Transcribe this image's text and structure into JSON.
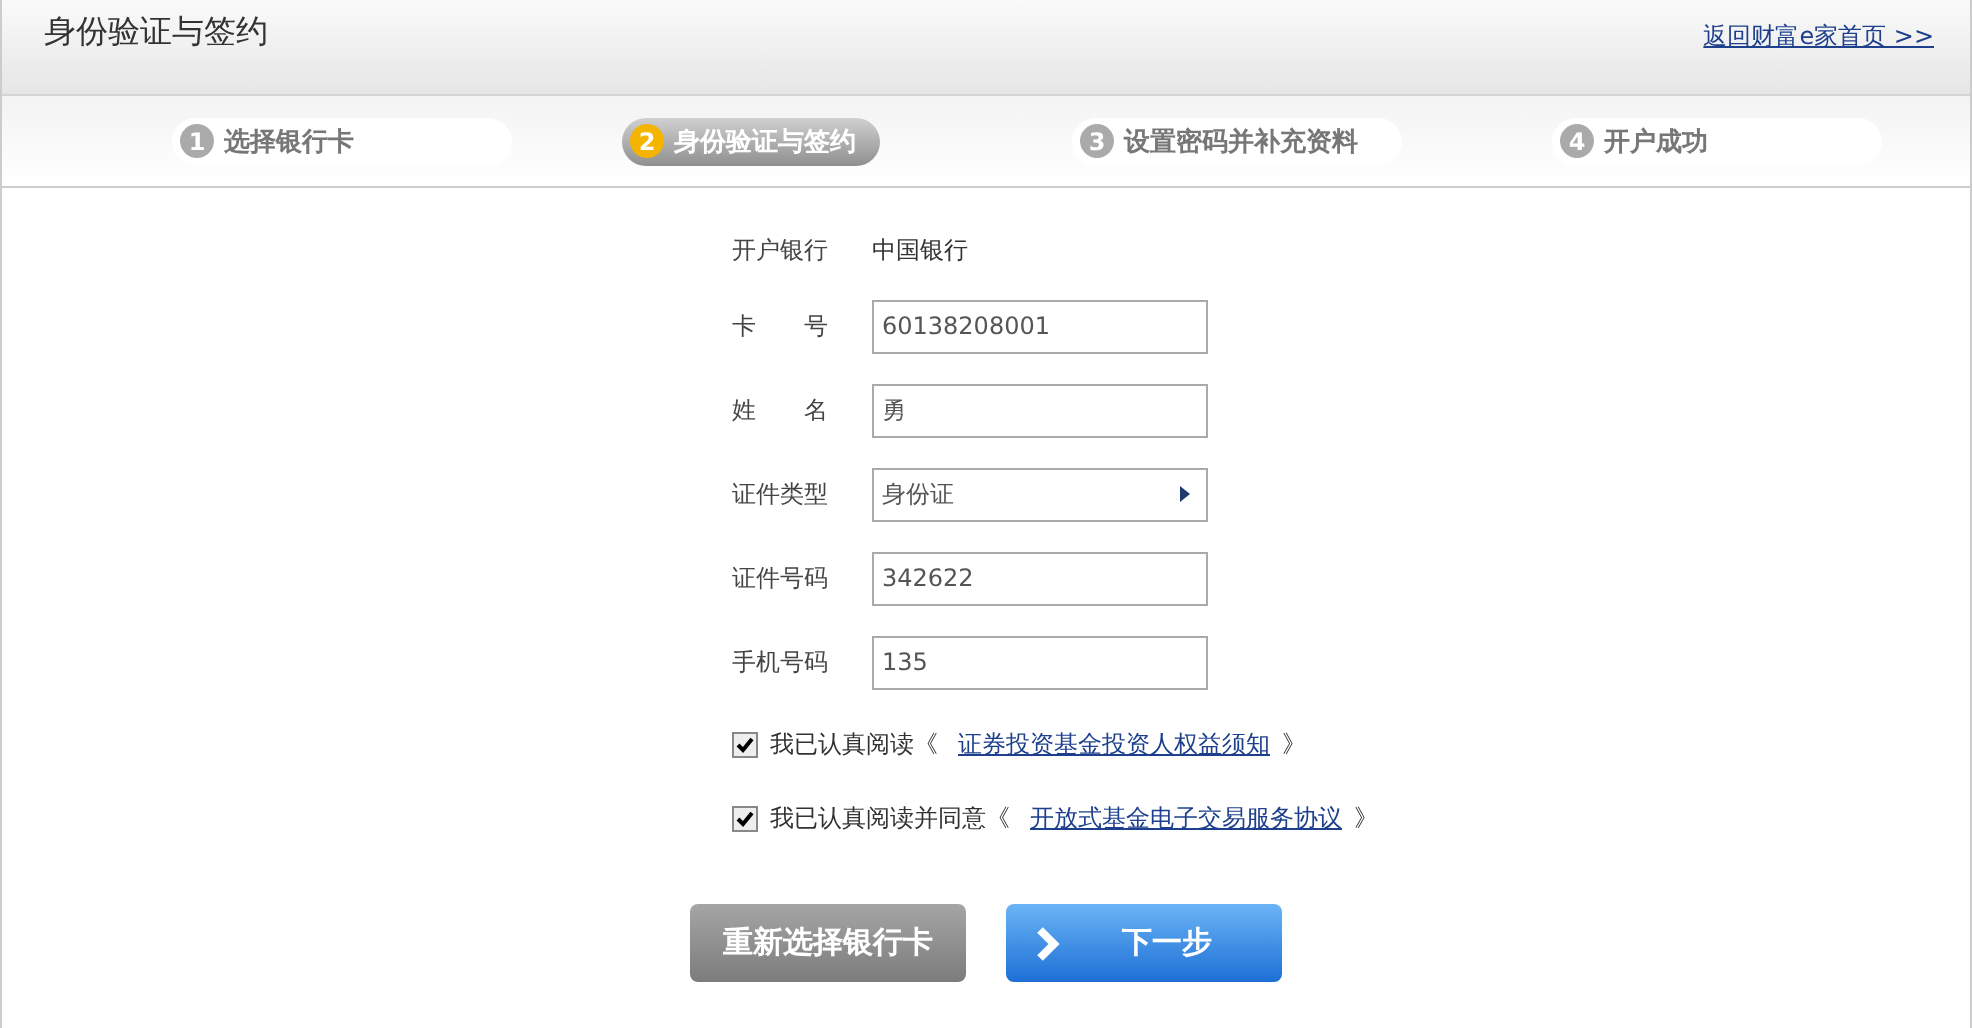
{
  "header": {
    "title": "身份验证与签约",
    "home_link": "返回财富e家首页 >>"
  },
  "steps": [
    {
      "number": "1",
      "label": "选择银行卡",
      "selected": false
    },
    {
      "number": "2",
      "label": "身份验证与签约",
      "selected": true
    },
    {
      "number": "3",
      "label": "设置密码并补充资料",
      "selected": false
    },
    {
      "number": "4",
      "label": "开户成功",
      "selected": false
    }
  ],
  "form": [
    {
      "kind": "static",
      "label": "开户银行",
      "value": "中国银行"
    },
    {
      "kind": "text",
      "label": "卡　　号",
      "value": "60138208001"
    },
    {
      "kind": "text",
      "label": "姓　　名",
      "value": "勇"
    },
    {
      "kind": "select",
      "label": "证件类型",
      "value": "身份证"
    },
    {
      "kind": "text",
      "label": "证件号码",
      "value": "342622"
    },
    {
      "kind": "text",
      "label": "手机号码",
      "value": "135"
    }
  ],
  "agreements": [
    {
      "checked": true,
      "text": "我已认真阅读《",
      "link": "证券投资基金投资人权益须知",
      "close": "》"
    },
    {
      "checked": true,
      "text": "我已认真阅读并同意《",
      "link": "开放式基金电子交易服务协议",
      "close": "》"
    }
  ],
  "buttons": {
    "back": "重新选择银行卡",
    "next": "下一步"
  }
}
